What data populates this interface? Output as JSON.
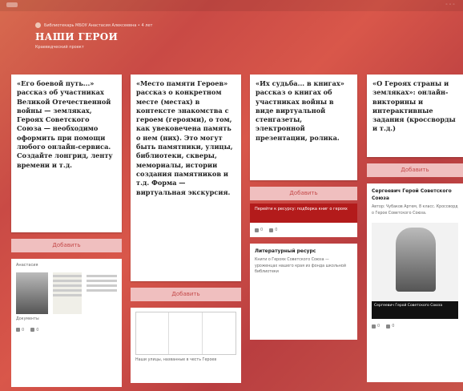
{
  "header": {
    "breadcrumb": "Библиотекарь МБОУ Анастасия Алексеевна • 4 лет",
    "title": "НАШИ ГЕРОИ",
    "subtitle": "Краеведческий проект"
  },
  "add_label": "Добавить",
  "columns": [
    {
      "card_text": "«Его боевой путь...» рассказ об участниках Великой Отечественной войны — земляках, Героях Советского Союза — необходимо оформить при помощи любого онлайн-сервиса. Создайте лонгрид, ленту времени и т.д.",
      "post": {
        "author": "Анастасия",
        "caption": "Документы",
        "likes": "0",
        "comments": "0"
      }
    },
    {
      "card_text": "«Место памяти Героев» рассказ о конкретном месте (местах) в контексте знакомства с героем (героями), о том, как увековечена память о нем (них). Это могут быть памятники, улицы, библиотеки, скверы, мемориалы, истории создания памятников и т.д. Форма — виртуальная экскурсия.",
      "post": {
        "caption": "Наши улицы, названные в честь Героев"
      }
    },
    {
      "card_text": "«Их судьба... в книгах» рассказ о книгах об участниках войны в виде виртуальной стенгазеты, электронной презентации, ролика.",
      "banner": "Перейти к ресурсу: подборка книг о героях",
      "post": {
        "title": "Литературный ресурс",
        "text": "Книги о Героях Советского Союза — уроженцах нашего края из фонда школьной библиотеки",
        "likes": "0",
        "comments": "0"
      }
    },
    {
      "card_text": "«О Героях страны и земляках»: онлайн-викторины и интерактивные задания (кроссворды и т.д.)",
      "post": {
        "title": "Сергеевич Герой Советского Союза",
        "text": "Автор: Чубаков Артем, 8 класс. Кроссворд о Герое Советского Союза.",
        "overlay": "Сергеевич Герой Советского Союза",
        "likes": "0",
        "comments": "0"
      }
    }
  ]
}
